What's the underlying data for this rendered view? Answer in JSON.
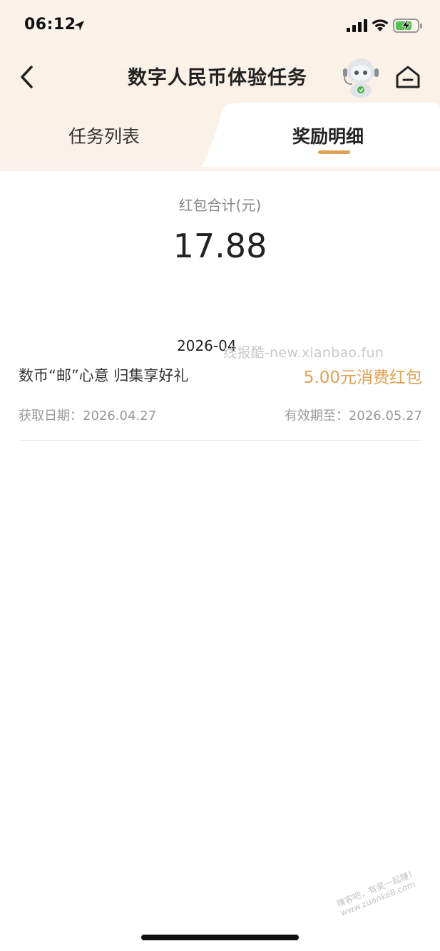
{
  "status_bar": {
    "time": "06:12"
  },
  "nav": {
    "title": "数字人民币体验任务"
  },
  "tabs": [
    {
      "label": "任务列表",
      "active": false
    },
    {
      "label": "奖励明细",
      "active": true
    }
  ],
  "summary": {
    "label": "红包合计(元)",
    "value": "17.88"
  },
  "month": "2026-04",
  "records": [
    {
      "title": "数币“邮”心意 归集享好礼",
      "amount": "5.00元消费红包",
      "obtain_date": "获取日期：2026.04.27",
      "expiry_date": "有效期至：2026.05.27"
    }
  ],
  "watermarks": {
    "top": "线报酷-new.xianbao.fun",
    "bottom_line1": "赚客吧，有奖一起赚！",
    "bottom_line2": "www.zuanke8.com"
  },
  "colors": {
    "accent": "#e0a155",
    "header_bg": "#fbf3ea",
    "battery_green": "#5ac05a"
  },
  "icons": {
    "back": "chevron-left-icon",
    "home": "home-icon",
    "mascot": "robot-mascot-icon"
  }
}
